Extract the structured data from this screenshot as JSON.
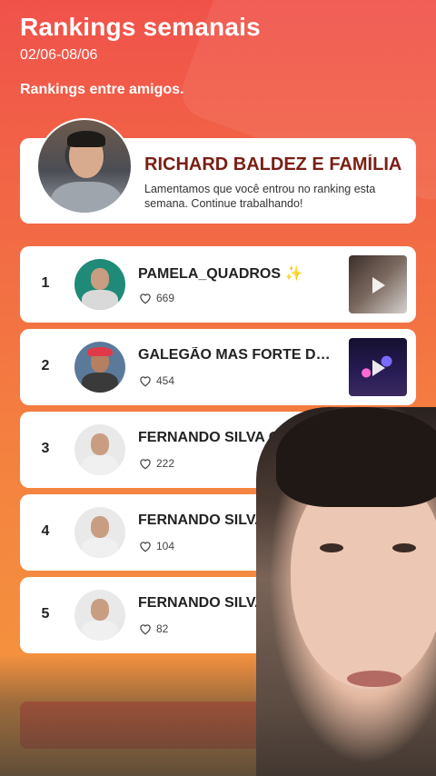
{
  "header": {
    "title": "Rankings semanais",
    "dates": "02/06-08/06",
    "subtitle": "Rankings entre amigos."
  },
  "my_rank": {
    "name": "RICHARD BALDEZ E FAMÍLIA",
    "message": "Lamentamos que você entrou no ranking esta semana. Continue trabalhando!"
  },
  "rankings": [
    {
      "rank": "1",
      "name": "PAMELA_QUADROS ✨",
      "likes": "669"
    },
    {
      "rank": "2",
      "name": "GALEGÃO MAS FORTE DO BRASIL",
      "likes": "454"
    },
    {
      "rank": "3",
      "name": "FERNANDO SILVA OFC",
      "likes": "222"
    },
    {
      "rank": "4",
      "name": "FERNANDO SILVA OFC",
      "likes": "104"
    },
    {
      "rank": "5",
      "name": "FERNANDO SILVA OFC",
      "likes": "82"
    }
  ],
  "icons": {
    "like": "heart-outline-icon",
    "play": "play-icon"
  },
  "colors": {
    "background_top": "#f0524a",
    "background_bottom": "#f59a3e",
    "name_accent": "#7a1e14",
    "button": "#e8362d"
  }
}
